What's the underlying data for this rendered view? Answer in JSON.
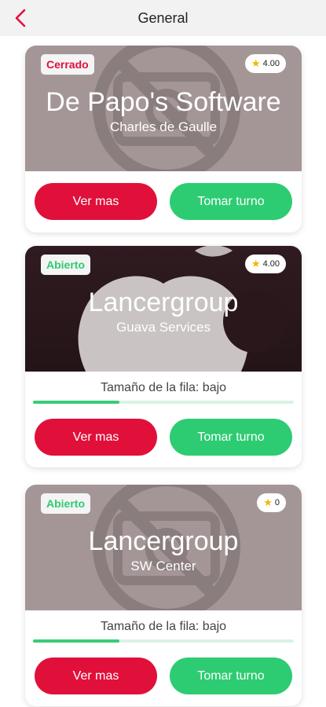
{
  "header": {
    "title": "General"
  },
  "colors": {
    "accent_red": "#e0103b",
    "accent_green": "#2dcc72",
    "closed": "#e0103b",
    "open": "#2dcc72"
  },
  "cards": [
    {
      "status": "Cerrado",
      "rating": "4.00",
      "title": "De Papo's Software",
      "subtitle": "Charles de Gaulle",
      "queue_text": null,
      "more_label": "Ver mas",
      "turn_label": "Tomar turno",
      "image": "no-image-placeholder"
    },
    {
      "status": "Abierto",
      "rating": "4.00",
      "title": "Lancergroup",
      "subtitle": "Guava Services",
      "queue_text": "Tamaño de la fila: bajo",
      "queue_level": 0.33,
      "more_label": "Ver mas",
      "turn_label": "Tomar turno",
      "image": "apple-logo"
    },
    {
      "status": "Abierto",
      "rating": "0",
      "title": "Lancergroup",
      "subtitle": "SW Center",
      "queue_text": "Tamaño de la fila: bajo",
      "queue_level": 0.33,
      "more_label": "Ver mas",
      "turn_label": "Tomar turno",
      "image": "no-image-placeholder"
    }
  ]
}
